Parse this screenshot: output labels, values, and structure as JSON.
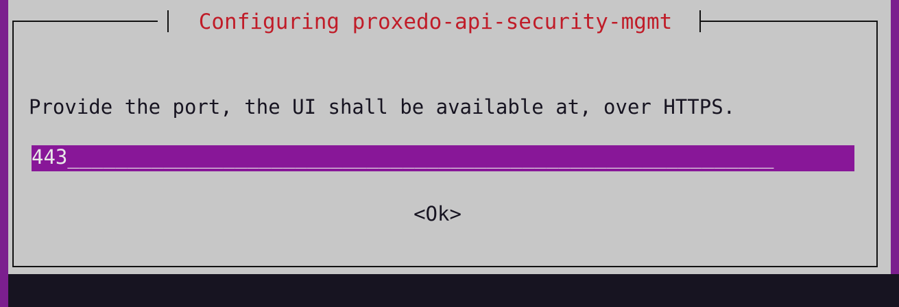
{
  "dialog": {
    "title": "Configuring proxedo-api-security-mgmt",
    "prompt": "Provide the port, the UI shall be available at, over HTTPS.",
    "input": {
      "value": "443",
      "fill": "___________________________________________________________"
    },
    "ok_label": "<Ok>"
  },
  "colors": {
    "terminal_bg": "#171421",
    "dialog_bg": "#c7c7c7",
    "accent_purple": "#881798",
    "title_red": "#c01c28"
  }
}
